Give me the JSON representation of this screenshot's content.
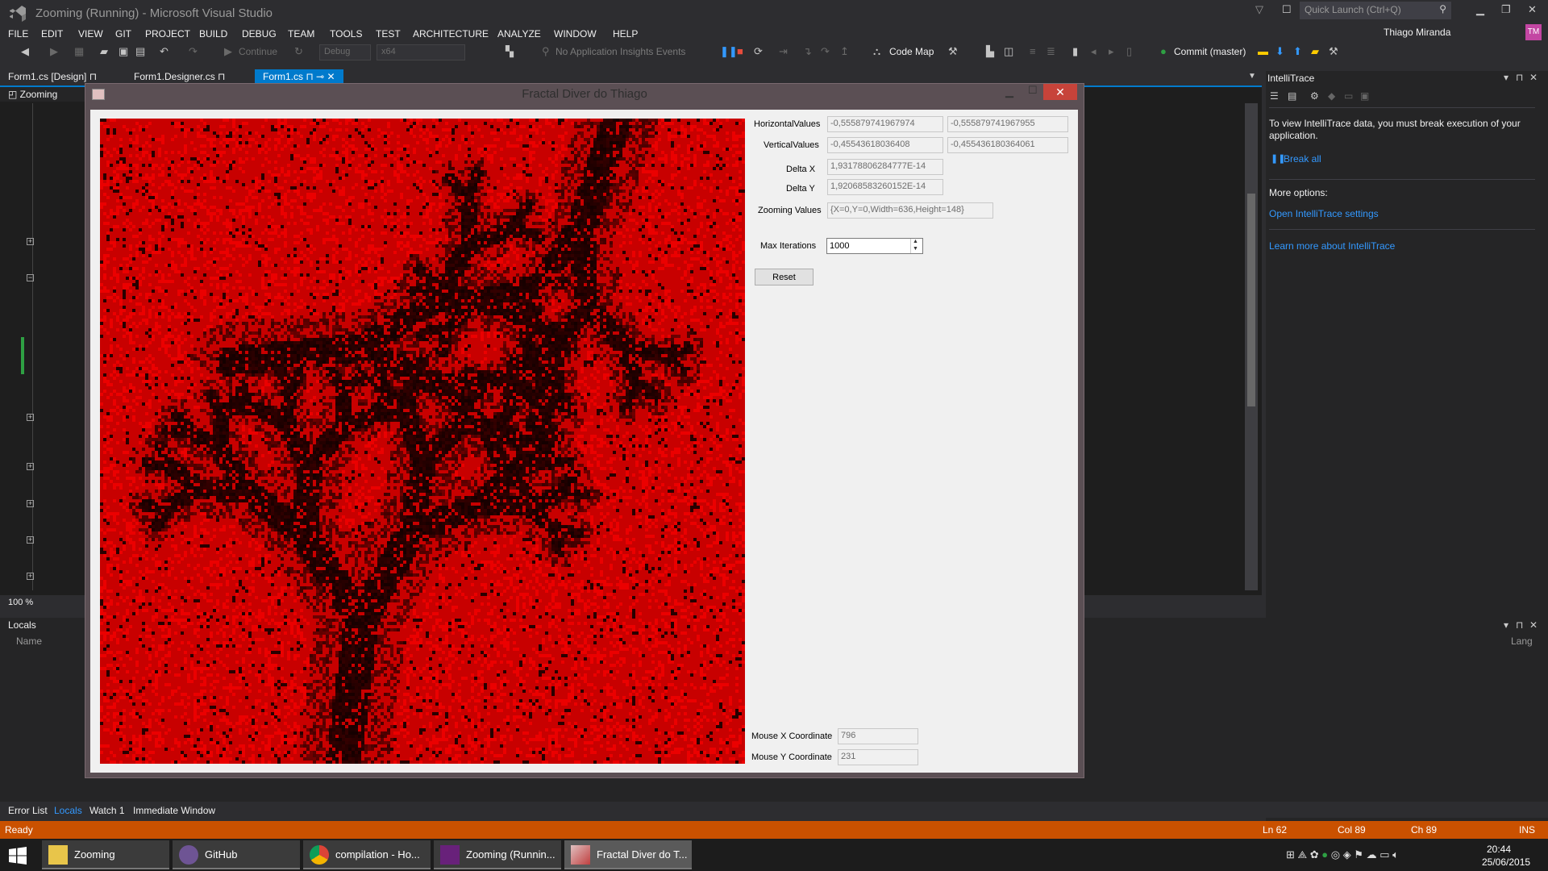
{
  "app": {
    "title": "Zooming (Running) - Microsoft Visual Studio"
  },
  "quick_launch": {
    "placeholder": "Quick Launch (Ctrl+Q)"
  },
  "user": {
    "name": "Thiago Miranda",
    "initials": "TM"
  },
  "menu": [
    "FILE",
    "EDIT",
    "VIEW",
    "GIT",
    "PROJECT",
    "BUILD",
    "DEBUG",
    "TEAM",
    "TOOLS",
    "TEST",
    "ARCHITECTURE",
    "ANALYZE",
    "WINDOW",
    "HELP"
  ],
  "toolbar": {
    "continue_label": "Continue",
    "config": "Debug",
    "platform": "x64",
    "insights_label": "No Application Insights Events",
    "codemap_label": "Code Map",
    "commit_label": "Commit (master)"
  },
  "doc_tabs": [
    {
      "label": "Form1.cs [Design]"
    },
    {
      "label": "Form1.Designer.cs"
    },
    {
      "label": "Form1.cs"
    }
  ],
  "editor": {
    "nav_class": "Zooming",
    "zoom": "100 %"
  },
  "intellitrace": {
    "title": "IntelliTrace",
    "message": "To view IntelliTrace data, you must break execution of your application.",
    "break_all": "Break all",
    "more_options": "More options:",
    "open_settings": "Open IntelliTrace settings",
    "learn_more": "Learn more about IntelliTrace"
  },
  "locals": {
    "title": "Locals",
    "col_name": "Name",
    "col_lang": "Lang"
  },
  "bottom_tabs": [
    "Error List",
    "Locals",
    "Watch 1",
    "Immediate Window"
  ],
  "status": {
    "ready": "Ready",
    "ln": "Ln 62",
    "col": "Col 89",
    "ch": "Ch 89",
    "mode": "INS"
  },
  "taskbar": {
    "apps": [
      {
        "label": "Zooming"
      },
      {
        "label": "GitHub"
      },
      {
        "label": "compilation - Ho..."
      },
      {
        "label": "Zooming (Runnin..."
      },
      {
        "label": "Fractal Diver do T..."
      }
    ],
    "time": "20:44",
    "date": "25/06/2015"
  },
  "fractal_window": {
    "title": "Fractal Diver do Thiago",
    "labels": {
      "horizontal": "HorizontalValues",
      "vertical": "VerticalValues",
      "delta_x": "Delta X",
      "delta_y": "Delta Y",
      "zooming": "Zooming Values",
      "max_iter": "Max Iterations",
      "mouse_x": "Mouse X Coordinate",
      "mouse_y": "Mouse Y Coordinate"
    },
    "values": {
      "h_min": "-0,555879741967974",
      "h_max": "-0,555879741967955",
      "v_min": "-0,45543618036408",
      "v_max": "-0,455436180364061",
      "delta_x": "1,93178806284777E-14",
      "delta_y": "1,92068583260152E-14",
      "zooming": "{X=0,Y=0,Width=636,Height=148}",
      "max_iter": "1000",
      "mouse_x": "796",
      "mouse_y": "231"
    },
    "reset_label": "Reset"
  }
}
